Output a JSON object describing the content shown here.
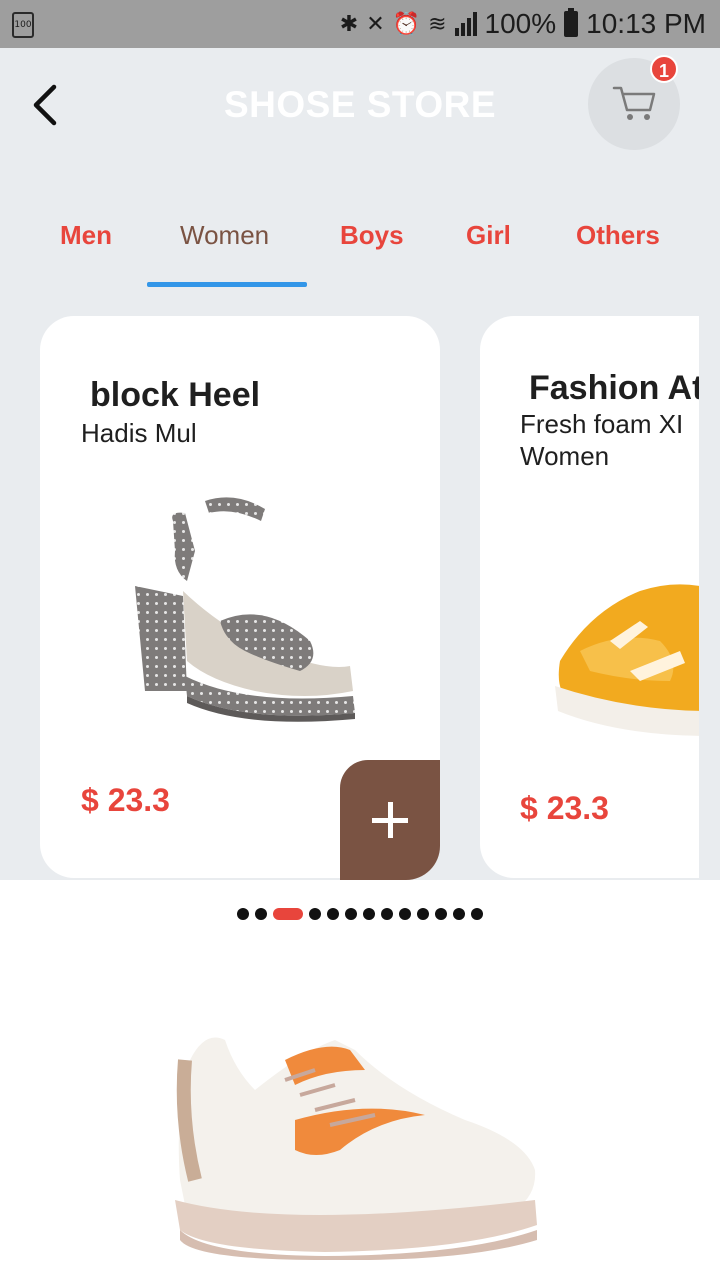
{
  "status_bar": {
    "battery_small": "100",
    "battery_percent": "100%",
    "time": "10:13 PM",
    "icons": [
      "bluetooth-icon",
      "vibrate-icon",
      "alarm-icon",
      "wifi-icon",
      "signal-icon",
      "battery-icon"
    ]
  },
  "header": {
    "title": "SHOSE STORE",
    "cart_count": "1"
  },
  "tabs": [
    {
      "label": "Men"
    },
    {
      "label": "Women"
    },
    {
      "label": "Boys"
    },
    {
      "label": "Girl"
    },
    {
      "label": "Others"
    }
  ],
  "active_tab": "Women",
  "products": [
    {
      "title": "block Heel",
      "subtitle": "Hadis Mul",
      "price": "$ 23.3"
    },
    {
      "title": "Fashion At",
      "subtitle_line1": "Fresh foam XI",
      "subtitle_line2": "Women",
      "price": "$ 23.3"
    }
  ],
  "pager": {
    "total": 13,
    "active_index": 2
  },
  "colors": {
    "accent_red": "#e8453c",
    "brown": "#7a5343",
    "tab_underline": "#3396e8",
    "background": "#e9ecef"
  }
}
